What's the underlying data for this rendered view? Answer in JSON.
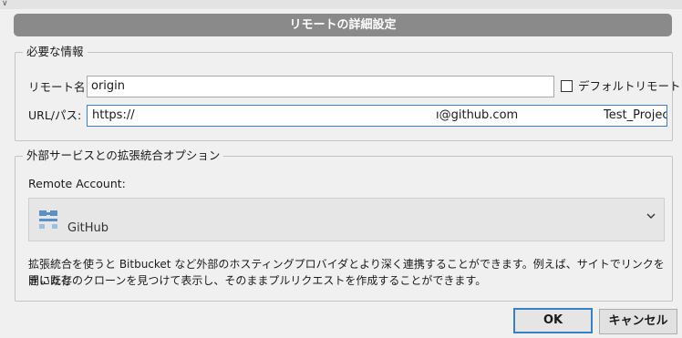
{
  "dialog": {
    "title": "リモートの詳細設定"
  },
  "required_info": {
    "legend": "必要な情報",
    "remote_name_label": "リモート名:",
    "remote_name_value": "origin",
    "default_remote_label": "デフォルトリモート",
    "default_remote_checked": false,
    "url_label": "URL/パス:",
    "url_part_1": "https://",
    "url_part_2": "ı@github.com",
    "url_part_3": "Test_Projec"
  },
  "integration": {
    "legend": "外部サービスとの拡張統合オプション",
    "remote_account_label": "Remote Account:",
    "remote_account_value": "GitHub",
    "remote_account_icon": "github-icon",
    "description_line_1": "拡張統合を使うと Bitbucket など外部のホスティングプロバイダとより深く連携することができます。例えば、サイトでリンクを開いたと",
    "description_line_2": "きに既存のクローンを見つけて表示し、そのままプルリクエストを作成することができます。"
  },
  "buttons": {
    "ok": "OK",
    "cancel": "キャンセル"
  },
  "colors": {
    "title_bar": "#8a8a8a",
    "focus_border": "#3b7fc4",
    "background": "#f0f0f0"
  }
}
